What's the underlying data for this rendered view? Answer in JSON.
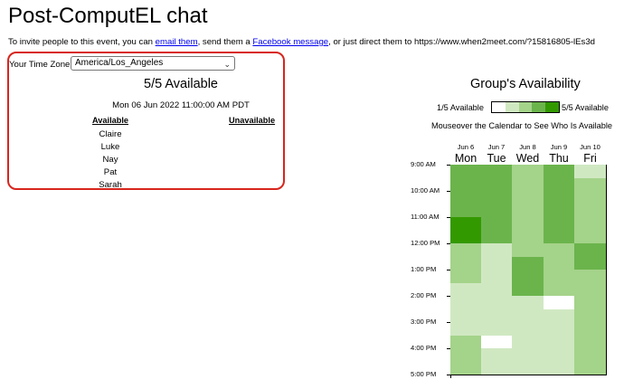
{
  "page": {
    "title": "Post-ComputEL chat",
    "invite": {
      "prefix": "To invite people to this event, you can ",
      "email_link": "email them",
      "middle": ", send them a ",
      "facebook_link": "Facebook message",
      "suffix": ", or just direct them to https://www.when2meet.com/?15816805-lEs3d"
    }
  },
  "left_panel": {
    "timezone_label": "Your Time Zone:",
    "timezone_value": "America/Los_Angeles",
    "available_count": "5/5 Available",
    "selected_datetime": "Mon 06 Jun 2022 11:00:00 AM PDT",
    "available_header": "Available",
    "unavailable_header": "Unavailable",
    "available_people": [
      "Claire",
      "Luke",
      "Nay",
      "Pat",
      "Sarah"
    ],
    "unavailable_people": []
  },
  "right_panel": {
    "title": "Group's Availability",
    "legend_min": "1/5 Available",
    "legend_max": "5/5 Available",
    "legend_colors": [
      "#ffffff",
      "#d0e8c2",
      "#a4d38a",
      "#6bb44c",
      "#339900"
    ],
    "hint": "Mouseover the Calendar to See Who Is Available",
    "days": [
      {
        "date": "Jun 6",
        "weekday": "Mon"
      },
      {
        "date": "Jun 7",
        "weekday": "Tue"
      },
      {
        "date": "Jun 8",
        "weekday": "Wed"
      },
      {
        "date": "Jun 9",
        "weekday": "Thu"
      },
      {
        "date": "Jun 10",
        "weekday": "Fri"
      }
    ],
    "times": [
      "9:00 AM",
      "10:00 AM",
      "11:00 AM",
      "12:00 PM",
      "1:00 PM",
      "2:00 PM",
      "3:00 PM",
      "4:00 PM",
      "5:00 PM"
    ],
    "availability_counts_note": "rows are half-hour slots 9:00 AM–5:00 PM, columns Mon–Fri; value = people available (0–5)",
    "availability_counts": [
      [
        4,
        4,
        3,
        4,
        2
      ],
      [
        4,
        4,
        3,
        4,
        3
      ],
      [
        4,
        4,
        3,
        4,
        3
      ],
      [
        4,
        4,
        3,
        4,
        3
      ],
      [
        5,
        4,
        3,
        4,
        3
      ],
      [
        5,
        4,
        3,
        4,
        3
      ],
      [
        3,
        2,
        3,
        3,
        4
      ],
      [
        3,
        2,
        4,
        3,
        4
      ],
      [
        3,
        2,
        4,
        3,
        3
      ],
      [
        2,
        2,
        4,
        3,
        3
      ],
      [
        2,
        2,
        2,
        0,
        3
      ],
      [
        2,
        2,
        2,
        2,
        3
      ],
      [
        2,
        2,
        2,
        2,
        3
      ],
      [
        3,
        0,
        2,
        2,
        3
      ],
      [
        3,
        2,
        2,
        2,
        3
      ],
      [
        3,
        2,
        2,
        2,
        3
      ]
    ]
  }
}
